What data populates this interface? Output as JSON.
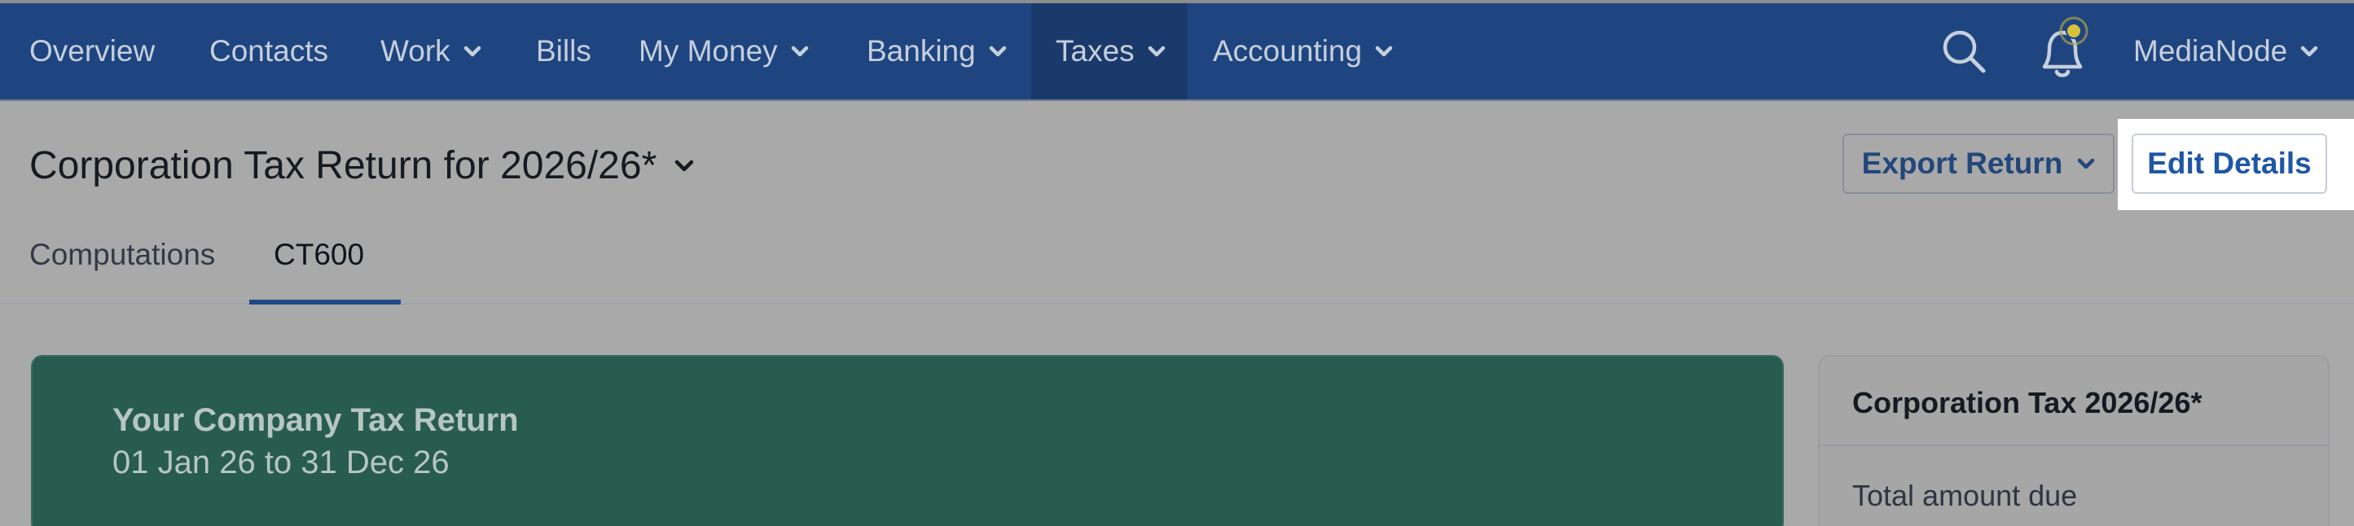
{
  "nav": {
    "items": [
      {
        "label": "Overview",
        "dropdown": false,
        "active": false
      },
      {
        "label": "Contacts",
        "dropdown": false,
        "active": false
      },
      {
        "label": "Work",
        "dropdown": true,
        "active": false
      },
      {
        "label": "Bills",
        "dropdown": false,
        "active": false
      },
      {
        "label": "My Money",
        "dropdown": true,
        "active": false
      },
      {
        "label": "Banking",
        "dropdown": true,
        "active": false
      },
      {
        "label": "Taxes",
        "dropdown": true,
        "active": true
      },
      {
        "label": "Accounting",
        "dropdown": true,
        "active": false
      }
    ],
    "account_label": "MediaNode",
    "icons": [
      "search-icon",
      "bell-icon"
    ]
  },
  "header": {
    "title": "Corporation Tax Return for 2026/26*",
    "export_label": "Export Return",
    "edit_label": "Edit Details"
  },
  "tabs": [
    {
      "label": "Computations",
      "active": false
    },
    {
      "label": "CT600",
      "active": true
    }
  ],
  "summary_card": {
    "title": "Your Company Tax Return",
    "period": "01 Jan 26 to 31 Dec 26"
  },
  "side_card": {
    "title": "Corporation Tax 2026/26*",
    "total_label": "Total amount due"
  },
  "colors": {
    "nav_bg": "#1f4580",
    "nav_active": "#1a3a6b",
    "card_green": "#285c4f",
    "accent_blue": "#1f56a6",
    "notification_dot": "#d8c23c"
  }
}
